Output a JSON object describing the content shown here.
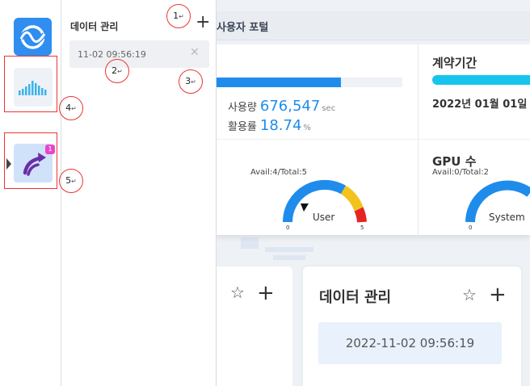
{
  "portal": {
    "title": "사용자 포털",
    "usage": {
      "fill_fraction": 0.67,
      "usage_label": "사용량",
      "usage_value": "676,547",
      "usage_unit": "sec",
      "rate_label": "활용률",
      "rate_value": "18.74",
      "rate_unit": "%"
    },
    "contract": {
      "title": "계약기간",
      "date": "2022년 01월 01일"
    },
    "gauge_left": {
      "avail": "Avail:4/Total:5",
      "label": "User",
      "min": "0",
      "max": "5"
    },
    "gpu": {
      "title": "GPU 수",
      "avail": "Avail:0/Total:2",
      "label": "System",
      "min": "0"
    },
    "card": {
      "title": "데이터 관리",
      "date": "2022-11-02 09:56:19"
    }
  },
  "panel": {
    "title": "데이터 관리",
    "item_text": "11-02 09:56:19"
  },
  "rail": {
    "badge": "1"
  },
  "callouts": [
    "1",
    "2",
    "3",
    "4",
    "5"
  ],
  "callout_mark": "↵",
  "colors": {
    "accent": "#1f8cec",
    "contract_bar": "#17c4ee",
    "gauge_blue": "#1f8cec",
    "gauge_yellow": "#f3c21b",
    "gauge_red": "#e52525",
    "badge": "#e845c8",
    "callout_border": "#ee3333"
  }
}
